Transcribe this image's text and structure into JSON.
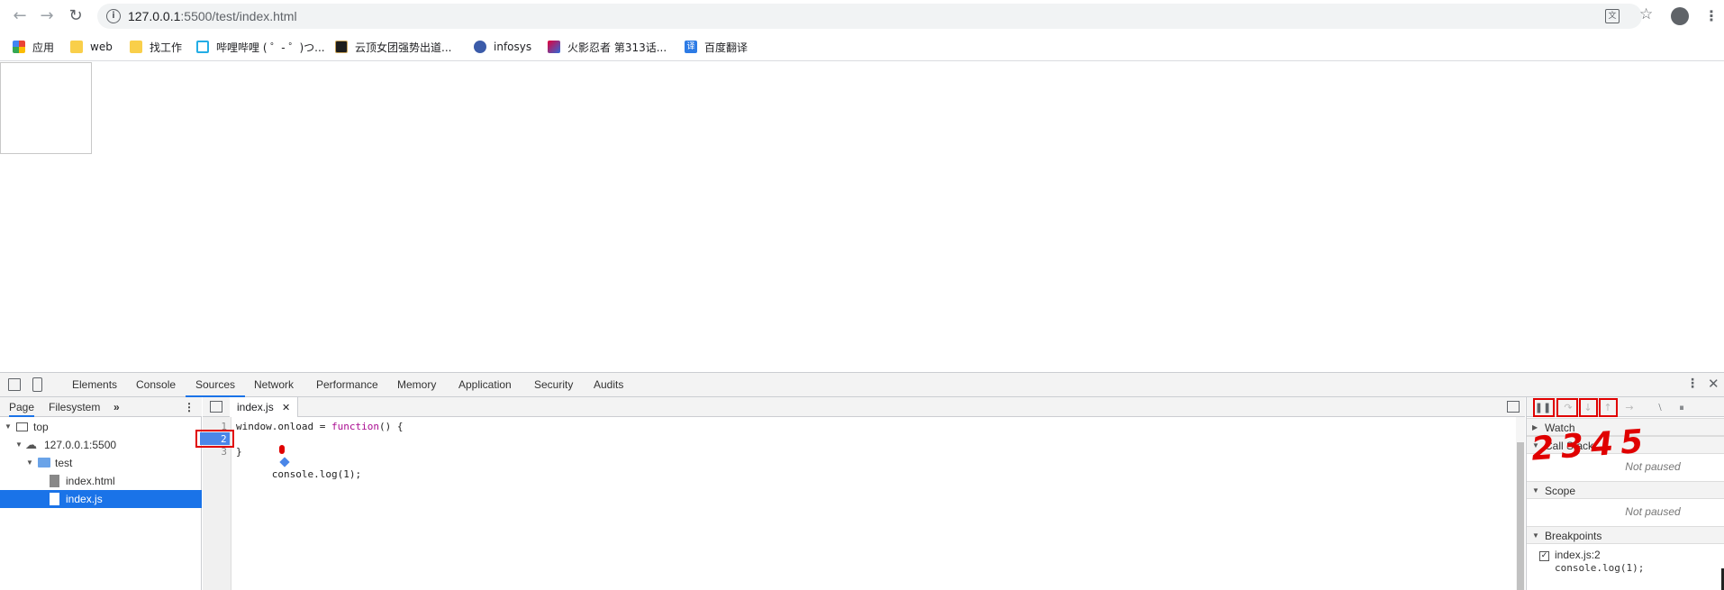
{
  "browser": {
    "url_host": "127.0.0.1",
    "url_rest": ":5500/test/index.html",
    "bookmarks": [
      "应用",
      "web",
      "找工作",
      "哔哩哔哩 ( ゜- ゜)つ...",
      "云顶女团强势出道...",
      "infosys",
      "火影忍者 第313话...",
      "百度翻译"
    ]
  },
  "devtools": {
    "tabs": [
      "Elements",
      "Console",
      "Sources",
      "Network",
      "Performance",
      "Memory",
      "Application",
      "Security",
      "Audits"
    ],
    "active_tab": "Sources",
    "nav_subtabs": [
      "Page",
      "Filesystem"
    ],
    "tree": [
      {
        "label": "top",
        "indent": 0
      },
      {
        "label": "127.0.0.1:5500",
        "indent": 1
      },
      {
        "label": "test",
        "indent": 2
      },
      {
        "label": "index.html",
        "indent": 3
      },
      {
        "label": "index.js",
        "indent": 3,
        "selected": true
      }
    ],
    "editor_tab": "index.js",
    "code_lines": [
      {
        "n": "1",
        "text": "window.onload = function() {"
      },
      {
        "n": "2",
        "text": "console.log(1);"
      },
      {
        "n": "3",
        "text": "}"
      }
    ],
    "sections": {
      "watch": "Watch",
      "call_stack": "Call Stack",
      "call_stack_status": "Not paused",
      "scope": "Scope",
      "scope_status": "Not paused",
      "breakpoints": "Breakpoints",
      "breakpoint_file": "index.js:2",
      "breakpoint_code": "console.log(1);"
    },
    "annotation": "2345"
  },
  "colors": {
    "accent": "#1a73e8",
    "annotation": "#e00000"
  }
}
